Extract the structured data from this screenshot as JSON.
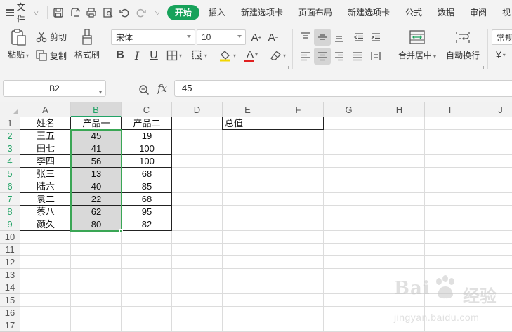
{
  "menu": {
    "file_label": "文件",
    "tabs": [
      {
        "label": "开始",
        "active": true
      },
      {
        "label": "插入",
        "active": false
      },
      {
        "label": "新建选项卡",
        "active": false
      },
      {
        "label": "页面布局",
        "active": false
      },
      {
        "label": "新建选项卡",
        "active": false
      },
      {
        "label": "公式",
        "active": false
      },
      {
        "label": "数据",
        "active": false
      },
      {
        "label": "审阅",
        "active": false
      },
      {
        "label": "视",
        "active": false
      }
    ]
  },
  "ribbon": {
    "paste_label": "粘贴",
    "cut_label": "剪切",
    "copy_label": "复制",
    "format_painter_label": "格式刷",
    "font_name": "宋体",
    "font_size": "10",
    "bold": "B",
    "italic": "I",
    "underline": "U",
    "font_color_glyph": "A",
    "merge_center_label": "合并居中",
    "wrap_text_label": "自动换行",
    "number_format": "常规",
    "currency_symbol": "¥",
    "accent_color": "#17a25a"
  },
  "formula_bar": {
    "name_box": "B2",
    "fx_label": "fx",
    "formula": "45"
  },
  "sheet": {
    "columns": [
      "A",
      "B",
      "C",
      "D",
      "E",
      "F",
      "G",
      "H",
      "I",
      "J"
    ],
    "rows": [
      "1",
      "2",
      "3",
      "4",
      "5",
      "6",
      "7",
      "8",
      "9",
      "10",
      "11",
      "12",
      "13",
      "14",
      "15",
      "16",
      "17"
    ],
    "selected_column": "B",
    "selected_rows": [
      "2",
      "3",
      "4",
      "5",
      "6",
      "7",
      "8",
      "9"
    ],
    "headers": {
      "A": "姓名",
      "B": "产品一",
      "C": "产品二",
      "E": "总值"
    },
    "data": [
      {
        "name": "王五",
        "p1": "45",
        "p2": "19"
      },
      {
        "name": "田七",
        "p1": "41",
        "p2": "100"
      },
      {
        "name": "李四",
        "p1": "56",
        "p2": "100"
      },
      {
        "name": "张三",
        "p1": "13",
        "p2": "68"
      },
      {
        "name": "陆六",
        "p1": "40",
        "p2": "85"
      },
      {
        "name": "袁二",
        "p1": "22",
        "p2": "68"
      },
      {
        "name": "蔡八",
        "p1": "62",
        "p2": "95"
      },
      {
        "name": "颜久",
        "p1": "80",
        "p2": "82"
      }
    ],
    "selection_color": "#3aa655"
  },
  "watermark": {
    "brand": "Bai",
    "brand_cn": "经验",
    "url": "jingyan.baidu.com"
  }
}
